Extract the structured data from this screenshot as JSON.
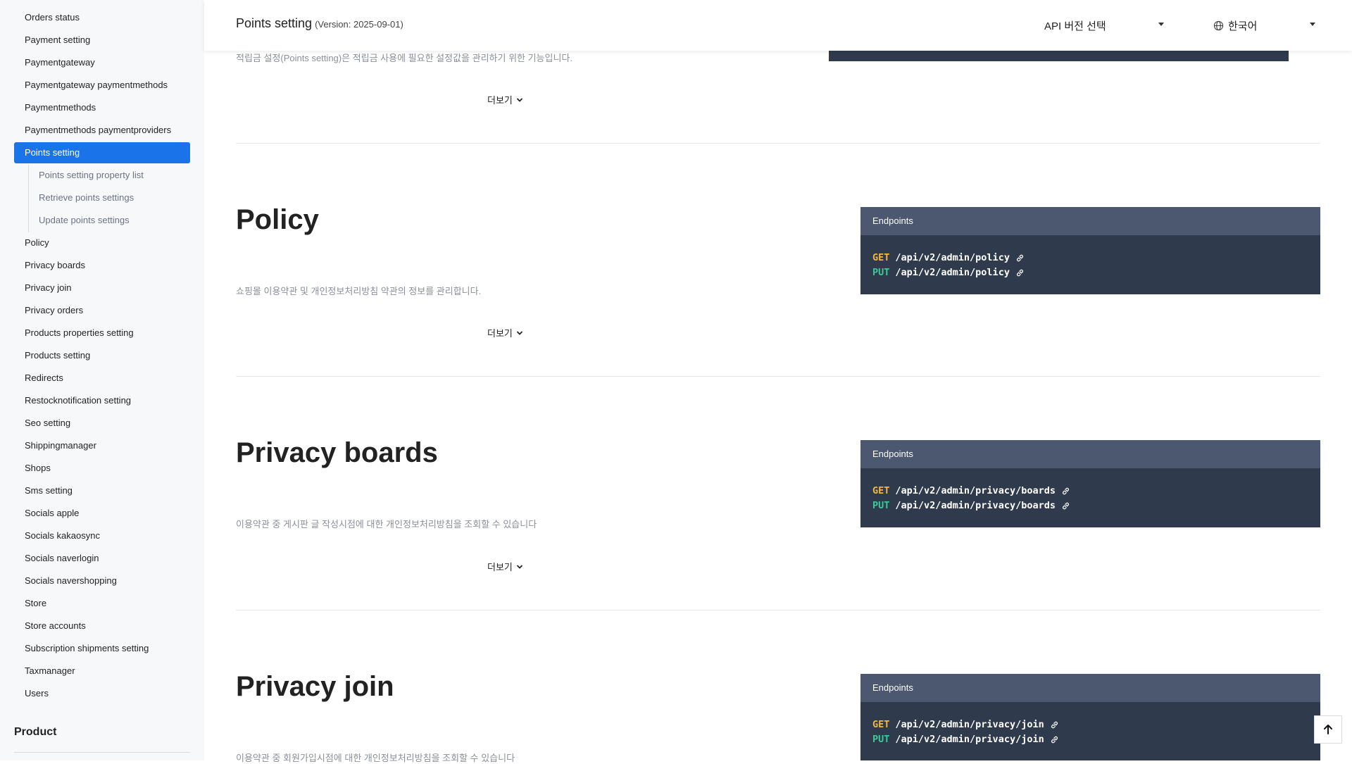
{
  "sidebar": {
    "items_before": [
      {
        "label": "Orders status"
      },
      {
        "label": "Payment setting"
      },
      {
        "label": "Paymentgateway"
      },
      {
        "label": "Paymentgateway paymentmethods"
      },
      {
        "label": "Paymentmethods"
      },
      {
        "label": "Paymentmethods paymentproviders"
      }
    ],
    "active": {
      "label": "Points setting"
    },
    "subitems": [
      {
        "label": "Points setting property list"
      },
      {
        "label": "Retrieve points settings"
      },
      {
        "label": "Update points settings"
      }
    ],
    "items_after": [
      {
        "label": "Policy"
      },
      {
        "label": "Privacy boards"
      },
      {
        "label": "Privacy join"
      },
      {
        "label": "Privacy orders"
      },
      {
        "label": "Products properties setting"
      },
      {
        "label": "Products setting"
      },
      {
        "label": "Redirects"
      },
      {
        "label": "Restocknotification setting"
      },
      {
        "label": "Seo setting"
      },
      {
        "label": "Shippingmanager"
      },
      {
        "label": "Shops"
      },
      {
        "label": "Sms setting"
      },
      {
        "label": "Socials apple"
      },
      {
        "label": "Socials kakaosync"
      },
      {
        "label": "Socials naverlogin"
      },
      {
        "label": "Socials navershopping"
      },
      {
        "label": "Store"
      },
      {
        "label": "Store accounts"
      },
      {
        "label": "Subscription shipments setting"
      },
      {
        "label": "Taxmanager"
      },
      {
        "label": "Users"
      }
    ],
    "heading": "Product"
  },
  "header": {
    "title": "Points setting",
    "version": "(Version: 2025-09-01)",
    "api_select": "API 버전 선택",
    "language": "한국어"
  },
  "top_section": {
    "desc": "적립금 설정(Points setting)은 적립금 사용에 필요한 설정값을 관리하기 위한 기능입니다.",
    "more": "더보기"
  },
  "sections": [
    {
      "title": "Policy",
      "desc": "쇼핑몰 이용약관 및 개인정보처리방침 약관의 정보를 관리합니다.",
      "more": "더보기",
      "endpoints_label": "Endpoints",
      "endpoints": [
        {
          "method": "GET",
          "path": "/api/v2/admin/policy"
        },
        {
          "method": "PUT",
          "path": "/api/v2/admin/policy"
        }
      ]
    },
    {
      "title": "Privacy boards",
      "desc": "이용약관 중 게시판 글 작성시점에 대한 개인정보처리방침을 조회할 수 있습니다",
      "more": "더보기",
      "endpoints_label": "Endpoints",
      "endpoints": [
        {
          "method": "GET",
          "path": "/api/v2/admin/privacy/boards"
        },
        {
          "method": "PUT",
          "path": "/api/v2/admin/privacy/boards"
        }
      ]
    },
    {
      "title": "Privacy join",
      "desc": "이용약관 중 회원가입시점에 대한 개인정보처리방침을 조회할 수 있습니다",
      "more": "더보기",
      "endpoints_label": "Endpoints",
      "endpoints": [
        {
          "method": "GET",
          "path": "/api/v2/admin/privacy/join"
        },
        {
          "method": "PUT",
          "path": "/api/v2/admin/privacy/join"
        }
      ]
    }
  ],
  "colors": {
    "active": "#1a73e8",
    "get": "#f5b83d",
    "put": "#3ec99a",
    "endpoint_bg": "#2f3a4c",
    "endpoint_head": "#4b5870"
  }
}
